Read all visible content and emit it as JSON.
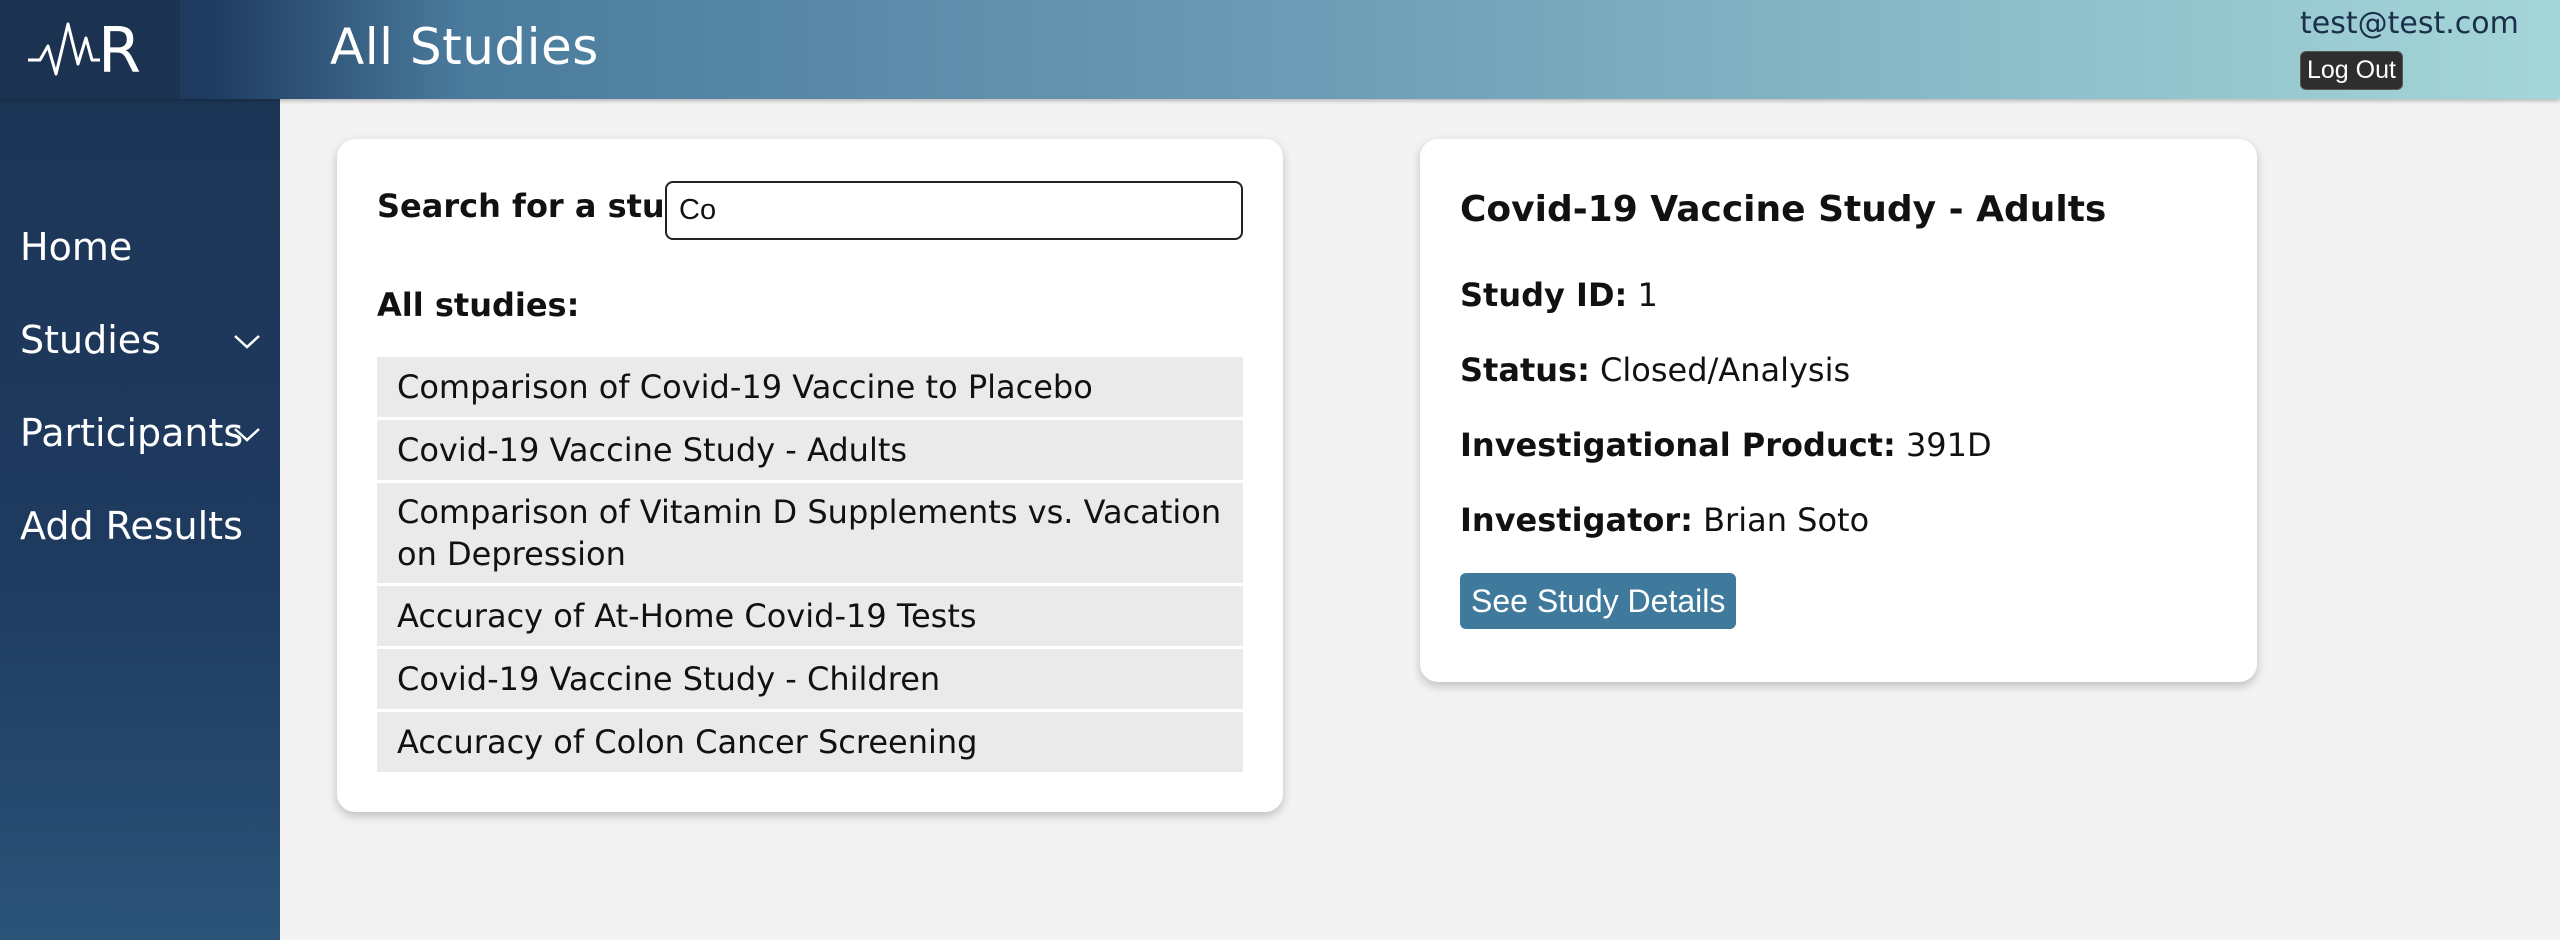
{
  "header": {
    "logo_text": "R",
    "title": "All Studies",
    "user_email": "test@test.com",
    "logout_label": "Log Out"
  },
  "sidebar": {
    "items": [
      {
        "label": "Home",
        "has_dropdown": false
      },
      {
        "label": "Studies",
        "has_dropdown": true
      },
      {
        "label": "Participants",
        "has_dropdown": true
      },
      {
        "label": "Add Results",
        "has_dropdown": false
      }
    ]
  },
  "search": {
    "label": "Search for a study:",
    "value": "Co",
    "list_heading": "All studies:",
    "results": [
      "Comparison of Covid-19 Vaccine to Placebo",
      "Covid-19 Vaccine Study - Adults",
      "Comparison of Vitamin D Supplements vs. Vacation on Depression",
      "Accuracy of At-Home Covid-19 Tests",
      "Covid-19 Vaccine Study - Children",
      "Accuracy of Colon Cancer Screening"
    ]
  },
  "detail": {
    "title": "Covid-19 Vaccine Study - Adults",
    "study_id_label": "Study ID:",
    "study_id": "1",
    "status_label": "Status:",
    "status": "Closed/Analysis",
    "product_label": "Investigational Product:",
    "product": "391D",
    "investigator_label": "Investigator:",
    "investigator": "Brian Soto",
    "button_label": "See Study Details"
  },
  "colors": {
    "sidebar": "#1e3a5f",
    "button": "#3f7a9c",
    "header_end": "#a5d6d8"
  },
  "icons": [
    "heartbeat-logo-icon",
    "chevron-down-icon"
  ]
}
